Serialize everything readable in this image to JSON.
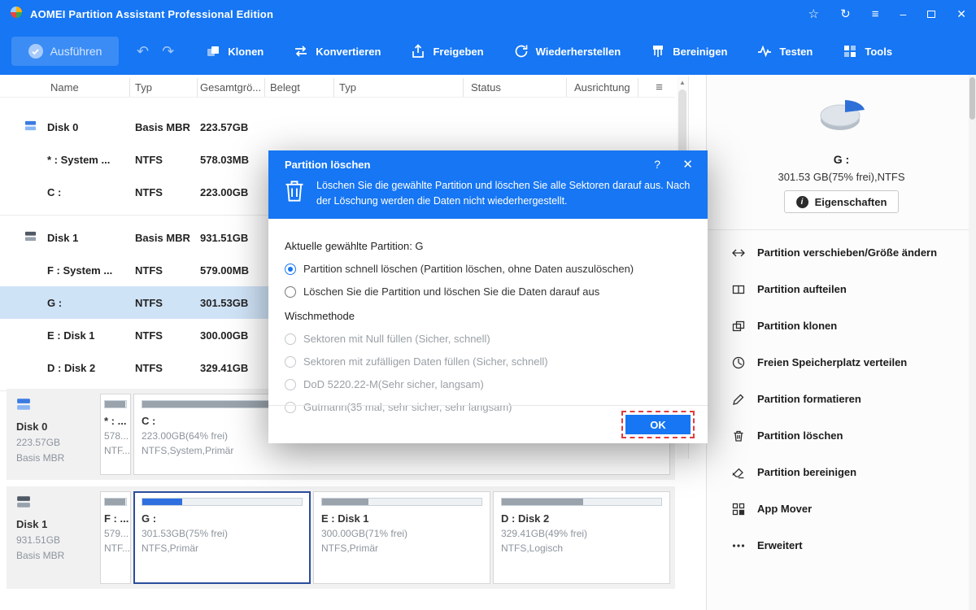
{
  "titlebar": {
    "app_title": "AOMEI Partition Assistant Professional Edition",
    "star": "☆",
    "refresh": "↻",
    "menu": "≡",
    "minimize": "–",
    "close": "✕"
  },
  "toolbar": {
    "execute": "Ausführen",
    "undo": "↶",
    "redo": "↷",
    "items": [
      "Klonen",
      "Konvertieren",
      "Freigeben",
      "Wiederherstellen",
      "Bereinigen",
      "Testen",
      "Tools"
    ]
  },
  "table": {
    "columns": [
      "Name",
      "Typ",
      "Gesamtgrö...",
      "Belegt",
      "Typ",
      "Status",
      "Ausrichtung"
    ],
    "rows": [
      {
        "name": "Disk 0",
        "type": "Basis MBR",
        "size": "223.57GB"
      },
      {
        "name": "* : System ...",
        "type": "NTFS",
        "size": "578.03MB"
      },
      {
        "name": "C :",
        "type": "NTFS",
        "size": "223.00GB"
      },
      {
        "name": "Disk 1",
        "type": "Basis MBR",
        "size": "931.51GB"
      },
      {
        "name": "F : System ...",
        "type": "NTFS",
        "size": "579.00MB"
      },
      {
        "name": "G :",
        "type": "NTFS",
        "size": "301.53GB"
      },
      {
        "name": "E : Disk 1",
        "type": "NTFS",
        "size": "300.00GB"
      },
      {
        "name": "D : Disk 2",
        "type": "NTFS",
        "size": "329.41GB"
      }
    ]
  },
  "disks": [
    {
      "name": "Disk 0",
      "size": "223.57GB",
      "style": "Basis MBR",
      "partitions": [
        {
          "name": "* : ...",
          "size": "578...",
          "fs": "NTF...",
          "used_percent": 95
        },
        {
          "name": "C :",
          "size": "223.00GB(64% frei)",
          "fs": "NTFS,System,Primär",
          "used_percent": 36
        }
      ]
    },
    {
      "name": "Disk 1",
      "size": "931.51GB",
      "style": "Basis MBR",
      "partitions": [
        {
          "name": "F : ...",
          "size": "579...",
          "fs": "NTF...",
          "used_percent": 95
        },
        {
          "name": "G :",
          "size": "301.53GB(75% frei)",
          "fs": "NTFS,Primär",
          "used_percent": 25
        },
        {
          "name": "E : Disk 1",
          "size": "300.00GB(71% frei)",
          "fs": "NTFS,Primär",
          "used_percent": 29
        },
        {
          "name": "D : Disk 2",
          "size": "329.41GB(49% frei)",
          "fs": "NTFS,Logisch",
          "used_percent": 51
        }
      ]
    }
  ],
  "sidebar": {
    "selected_partition": "G :",
    "selected_details": "301.53 GB(75% frei),NTFS",
    "properties": "Eigenschaften",
    "menu": [
      "Partition verschieben/Größe ändern",
      "Partition aufteilen",
      "Partition klonen",
      "Freien Speicherplatz verteilen",
      "Partition formatieren",
      "Partition löschen",
      "Partition bereinigen",
      "App Mover",
      "Erweitert"
    ]
  },
  "dialog": {
    "title": "Partition löschen",
    "help": "?",
    "close": "✕",
    "description": "Löschen Sie die gewählte Partition und löschen Sie alle Sektoren darauf aus. Nach der Löschung werden die Daten nicht wiederhergestellt.",
    "current_partition": "Aktuelle gewählte Partition: G",
    "option_quick": "Partition schnell löschen (Partition löschen, ohne Daten auszulöschen)",
    "option_quick_checked": true,
    "option_wipe": "Löschen Sie die Partition und löschen Sie die Daten darauf aus",
    "option_wipe_checked": false,
    "wipe_method_label": "Wischmethode",
    "wipe_methods": [
      "Sektoren mit Null füllen (Sicher, schnell)",
      "Sektoren mit zufälligen Daten füllen (Sicher, schnell)",
      "DoD 5220.22-M(Sehr sicher, langsam)",
      "Gutmann(35 mal, sehr sicher, sehr langsam)"
    ],
    "ok": "OK"
  },
  "colors": {
    "accent": "#1676f3",
    "row_selection": "#cfe3f7",
    "bar_fill_selected": "#2e6fe0",
    "bar_fill": "#9aa3ac"
  }
}
